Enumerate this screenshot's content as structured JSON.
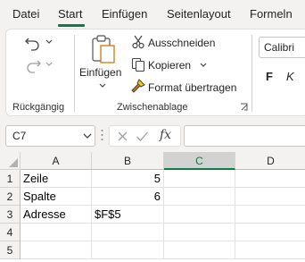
{
  "ribbon_tabs": [
    {
      "label": "Datei"
    },
    {
      "label": "Start",
      "active": true
    },
    {
      "label": "Einfügen"
    },
    {
      "label": "Seitenlayout"
    },
    {
      "label": "Formeln"
    }
  ],
  "groups": {
    "undo": {
      "label": "Rückgängig"
    },
    "clipboard": {
      "label": "Zwischenablage",
      "paste_label": "Einfügen",
      "cut_label": "Ausschneiden",
      "copy_label": "Kopieren",
      "format_painter_label": "Format übertragen"
    },
    "font": {
      "font_name": "Calibri",
      "bold_label": "F",
      "italic_label": "K"
    }
  },
  "formula_bar": {
    "name_box": "C7",
    "fx_label": "fx",
    "formula": ""
  },
  "sheet": {
    "columns": [
      "A",
      "B",
      "C",
      "D"
    ],
    "selected_column": "C",
    "rows": [
      "1",
      "2",
      "3",
      "4",
      "5"
    ],
    "cells": [
      [
        "Zeile",
        "5",
        "",
        ""
      ],
      [
        "Spalte",
        "6",
        "",
        ""
      ],
      [
        "Adresse",
        "$F$5",
        "",
        ""
      ],
      [
        "",
        "",
        "",
        ""
      ],
      [
        "",
        "",
        "",
        ""
      ]
    ]
  },
  "colors": {
    "accent": "#107c41",
    "ribbon_bg": "#f3f2f1",
    "header_selected": "#d2d2d2"
  }
}
